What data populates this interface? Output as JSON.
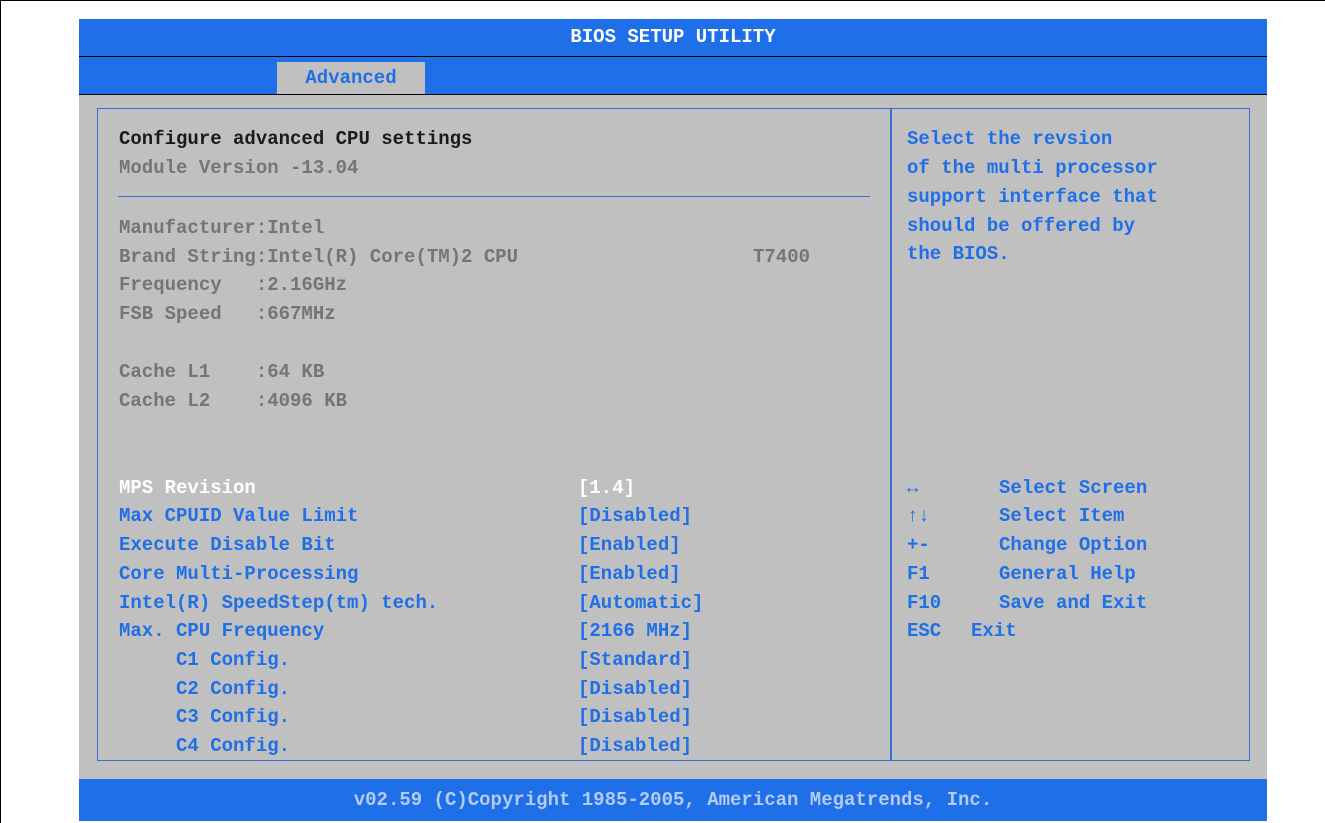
{
  "title": "BIOS SETUP UTILITY",
  "active_tab": "Advanced",
  "main": {
    "heading": "Configure advanced CPU settings",
    "module_version": "Module Version -13.04",
    "info": [
      {
        "label": "Manufacturer",
        "value": ":Intel"
      },
      {
        "label": "Brand String",
        "value": ":Intel(R) Core(TM)2 CPU",
        "extra": "T7400"
      },
      {
        "label": "Frequency   ",
        "value": ":2.16GHz"
      },
      {
        "label": "FSB Speed   ",
        "value": ":667MHz"
      },
      {
        "label": "Cache L1    ",
        "value": ":64 KB"
      },
      {
        "label": "Cache L2    ",
        "value": ":4096 KB"
      }
    ],
    "settings": [
      {
        "label": "MPS Revision",
        "value": "[1.4]"
      },
      {
        "label": "Max CPUID Value Limit",
        "value": "[Disabled]"
      },
      {
        "label": "Execute Disable Bit",
        "value": "[Enabled]"
      },
      {
        "label": "Core Multi-Processing",
        "value": "[Enabled]"
      },
      {
        "label": "Intel(R) SpeedStep(tm) tech.",
        "value": "[Automatic]"
      },
      {
        "label": "Max. CPU Frequency",
        "value": "[2166 MHz]"
      },
      {
        "label": "C1 Config.",
        "value": "[Standard]"
      },
      {
        "label": "C2 Config.",
        "value": "[Disabled]"
      },
      {
        "label": "C3 Config.",
        "value": "[Disabled]"
      },
      {
        "label": "C4 Config.",
        "value": "[Disabled]"
      }
    ]
  },
  "help": {
    "lines": [
      "Select the revsion",
      "of the multi processor",
      "support interface that",
      "should be offered by",
      "the BIOS."
    ],
    "keys": [
      {
        "key": "↔",
        "desc": "Select Screen",
        "icon": "left-right-arrow-icon"
      },
      {
        "key": "↑↓",
        "desc": "Select Item",
        "icon": "up-down-arrow-icon"
      },
      {
        "key": "+-",
        "desc": "Change Option"
      },
      {
        "key": "F1",
        "desc": "General Help"
      },
      {
        "key": "F10",
        "desc": "Save and Exit"
      },
      {
        "key": "ESC",
        "desc": "Exit"
      }
    ]
  },
  "footer": "v02.59 (C)Copyright 1985-2005, American Megatrends, Inc.",
  "colors": {
    "bar_blue": "#1e6fe8",
    "panel_gray": "#c0c0c0",
    "selected_text": "#ffffff",
    "info_text": "#757575"
  }
}
